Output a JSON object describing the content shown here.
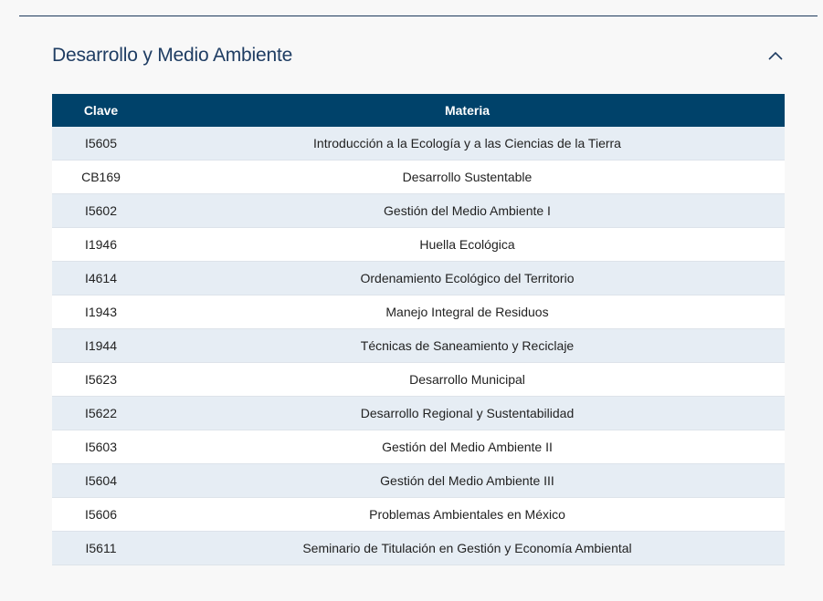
{
  "section": {
    "title": "Desarrollo y Medio Ambiente",
    "toggle_icon": "chevron-up-icon"
  },
  "table": {
    "headers": {
      "clave": "Clave",
      "materia": "Materia"
    },
    "rows": [
      {
        "clave": "I5605",
        "materia": "Introducción a la Ecología y a las Ciencias de la Tierra"
      },
      {
        "clave": "CB169",
        "materia": "Desarrollo Sustentable"
      },
      {
        "clave": "I5602",
        "materia": "Gestión del Medio Ambiente I"
      },
      {
        "clave": "I1946",
        "materia": "Huella Ecológica"
      },
      {
        "clave": "I4614",
        "materia": "Ordenamiento Ecológico del Territorio"
      },
      {
        "clave": "I1943",
        "materia": "Manejo Integral de Residuos"
      },
      {
        "clave": "I1944",
        "materia": "Técnicas de Saneamiento y Reciclaje"
      },
      {
        "clave": "I5623",
        "materia": "Desarrollo Municipal"
      },
      {
        "clave": "I5622",
        "materia": "Desarrollo Regional y Sustentabilidad"
      },
      {
        "clave": "I5603",
        "materia": "Gestión del Medio Ambiente II"
      },
      {
        "clave": "I5604",
        "materia": "Gestión del Medio Ambiente III"
      },
      {
        "clave": "I5606",
        "materia": "Problemas Ambientales en México"
      },
      {
        "clave": "I5611",
        "materia": "Seminario de Titulación en Gestión y Economía Ambiental"
      }
    ]
  },
  "colors": {
    "header_bg": "#00426a",
    "row_alt_bg": "#e6edf4",
    "title_color": "#1f3d63"
  }
}
